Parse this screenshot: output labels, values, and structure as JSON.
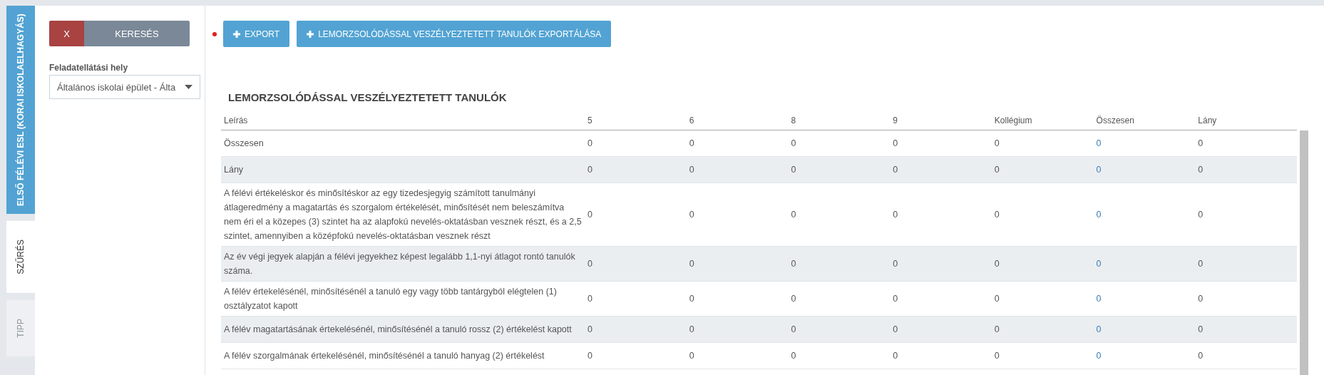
{
  "side_title": "ELSŐ FÉLÉVI ESL (KORAI ISKOLAELHAGYÁS)",
  "side_tabs": [
    {
      "label": "SZŰRÉS",
      "selected": true,
      "disabled": false
    },
    {
      "label": "TIPP",
      "selected": false,
      "disabled": true
    }
  ],
  "filter": {
    "clear_button": "X",
    "search_button": "KERESÉS",
    "field_label": "Feladatellátási hely",
    "field_value": "Általános iskolai épület - Álta"
  },
  "toolbar": {
    "buttons": [
      "EXPORT",
      "LEMORZSOLÓDÁSSAL VESZÉLYEZTETETT TANULÓK EXPORTÁLÁSA"
    ]
  },
  "table": {
    "title": "LEMORZSOLÓDÁSSAL VESZÉLYEZTETETT TANULÓK",
    "columns": [
      {
        "label": "Leírás",
        "kind": "text"
      },
      {
        "label": "5",
        "kind": "number"
      },
      {
        "label": "6",
        "kind": "number"
      },
      {
        "label": "8",
        "kind": "number"
      },
      {
        "label": "9",
        "kind": "number"
      },
      {
        "label": "Kollégium",
        "kind": "number"
      },
      {
        "label": "Összesen",
        "kind": "link"
      },
      {
        "label": "Lány",
        "kind": "number"
      }
    ],
    "rows": [
      [
        "Összesen",
        "0",
        "0",
        "0",
        "0",
        "0",
        "0",
        "0"
      ],
      [
        "Lány",
        "0",
        "0",
        "0",
        "0",
        "0",
        "0",
        "0"
      ],
      [
        "A félévi értékeléskor és minősítéskor az egy tizedesjegyig számított tanulmányi átlageredmény a magatartás és szorgalom értékelését, minősítését nem beleszámítva nem éri el a közepes (3) szintet ha az alapfokú nevelés-oktatásban vesznek részt, és a 2,5 szintet, amennyiben a középfokú nevelés-oktatásban vesznek részt",
        "0",
        "0",
        "0",
        "0",
        "0",
        "0",
        "0"
      ],
      [
        "Az év végi jegyek alapján a félévi jegyekhez képest legalább 1,1-nyi átlagot rontó tanulók száma.",
        "0",
        "0",
        "0",
        "0",
        "0",
        "0",
        "0"
      ],
      [
        "A félév értekelésénél, minősítésénél a tanuló egy vagy több tantárgyból elégtelen (1) osztályzatot kapott",
        "0",
        "0",
        "0",
        "0",
        "0",
        "0",
        "0"
      ],
      [
        "A félév magatartásának értekelésénél, minősítésénél a tanuló rossz (2) értékelést kapott",
        "0",
        "0",
        "0",
        "0",
        "0",
        "0",
        "0"
      ],
      [
        "A félév szorgalmának értekelésénél, minősítésénél a tanuló hanyag (2) értékelést",
        "0",
        "0",
        "0",
        "0",
        "0",
        "0",
        "0"
      ]
    ]
  }
}
